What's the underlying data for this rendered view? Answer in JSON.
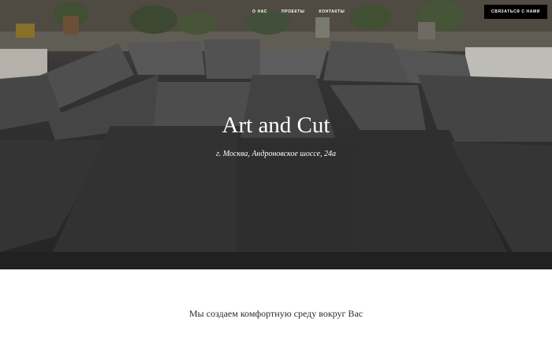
{
  "nav": {
    "items": [
      {
        "label": "О нас"
      },
      {
        "label": "Проекты"
      },
      {
        "label": "Контакты"
      }
    ]
  },
  "header": {
    "cta_label": "Связаться с нами"
  },
  "hero": {
    "title": "Art and Cut",
    "address": "г. Москва, Андроновское шоссе, 24а"
  },
  "intro": {
    "tagline": "Мы создаем комфортную среду вокруг Вас"
  }
}
